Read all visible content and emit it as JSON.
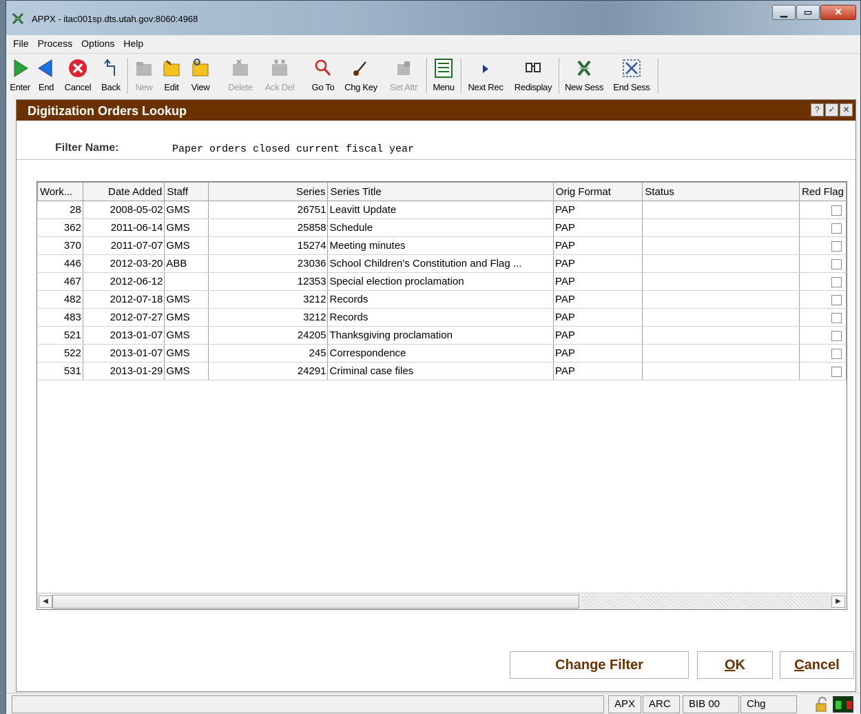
{
  "window": {
    "title": "APPX - itac001sp.dts.utah.gov:8060:4968",
    "controls": [
      "minimize",
      "maximize",
      "close"
    ]
  },
  "menu": [
    "File",
    "Process",
    "Options",
    "Help"
  ],
  "toolbar": {
    "buttons": [
      {
        "label": "Enter",
        "icon": "enter-arrow-icon",
        "enabled": true
      },
      {
        "label": "End",
        "icon": "end-arrow-icon",
        "enabled": true
      },
      {
        "label": "Cancel",
        "icon": "cancel-x-icon",
        "enabled": true
      },
      {
        "label": "Back",
        "icon": "back-arrow-icon",
        "enabled": true
      },
      {
        "label": "New",
        "icon": "new-folder-icon",
        "enabled": false
      },
      {
        "label": "Edit",
        "icon": "edit-folder-icon",
        "enabled": true
      },
      {
        "label": "View",
        "icon": "view-folder-icon",
        "enabled": true
      },
      {
        "label": "Delete",
        "icon": "delete-folder-icon",
        "enabled": false
      },
      {
        "label": "Ack Del",
        "icon": "ack-del-folder-icon",
        "enabled": false
      },
      {
        "label": "Go To",
        "icon": "magnifier-icon",
        "enabled": true
      },
      {
        "label": "Chg Key",
        "icon": "change-key-icon",
        "enabled": true
      },
      {
        "label": "Set Attr",
        "icon": "set-attr-icon",
        "enabled": false
      },
      {
        "label": "Menu",
        "icon": "menu-list-icon",
        "enabled": true
      },
      {
        "label": "Next Rec",
        "icon": "next-record-icon",
        "enabled": true
      },
      {
        "label": "Redisplay",
        "icon": "binoculars-icon",
        "enabled": true
      },
      {
        "label": "New Sess",
        "icon": "new-session-icon",
        "enabled": true
      },
      {
        "label": "End Sess",
        "icon": "end-session-icon",
        "enabled": true
      }
    ]
  },
  "dialog": {
    "title": "Digitization Orders Lookup",
    "controls": [
      "?",
      "✓",
      "✕"
    ],
    "filter_label": "Filter Name:",
    "filter_value": "Paper orders closed current fiscal year",
    "columns": [
      "Work...",
      "Date Added",
      "Staff",
      "Series",
      "Series Title",
      "Orig Format",
      "Status",
      "Red Flag"
    ],
    "rows": [
      {
        "work": "28",
        "date": "2008-05-02",
        "staff": "GMS",
        "series": "26751",
        "title": "Leavitt Update",
        "format": "PAP",
        "status": "",
        "red_flag": false
      },
      {
        "work": "362",
        "date": "2011-06-14",
        "staff": "GMS",
        "series": "25858",
        "title": "Schedule",
        "format": "PAP",
        "status": "",
        "red_flag": false
      },
      {
        "work": "370",
        "date": "2011-07-07",
        "staff": "GMS",
        "series": "15274",
        "title": "Meeting minutes",
        "format": "PAP",
        "status": "",
        "red_flag": false
      },
      {
        "work": "446",
        "date": "2012-03-20",
        "staff": "ABB",
        "series": "23036",
        "title": "School Children's Constitution and Flag ...",
        "format": "PAP",
        "status": "",
        "red_flag": false
      },
      {
        "work": "467",
        "date": "2012-06-12",
        "staff": "",
        "series": "12353",
        "title": "Special election proclamation",
        "format": "PAP",
        "status": "",
        "red_flag": false
      },
      {
        "work": "482",
        "date": "2012-07-18",
        "staff": "GMS",
        "series": "3212",
        "title": "Records",
        "format": "PAP",
        "status": "",
        "red_flag": false
      },
      {
        "work": "483",
        "date": "2012-07-27",
        "staff": "GMS",
        "series": "3212",
        "title": "Records",
        "format": "PAP",
        "status": "",
        "red_flag": false
      },
      {
        "work": "521",
        "date": "2013-01-07",
        "staff": "GMS",
        "series": "24205",
        "title": "Thanksgiving proclamation",
        "format": "PAP",
        "status": "",
        "red_flag": false
      },
      {
        "work": "522",
        "date": "2013-01-07",
        "staff": "GMS",
        "series": "245",
        "title": "Correspondence",
        "format": "PAP",
        "status": "",
        "red_flag": false
      },
      {
        "work": "531",
        "date": "2013-01-29",
        "staff": "GMS",
        "series": "24291",
        "title": "Criminal case files",
        "format": "PAP",
        "status": "",
        "red_flag": false
      }
    ],
    "buttons": {
      "change_filter": "Change Filter",
      "ok_mnemonic": "O",
      "ok_rest": "K",
      "cancel_mnemonic": "C",
      "cancel_rest": "ancel"
    }
  },
  "statusbar": {
    "message": "",
    "fields": [
      "APX",
      "ARC",
      "BIB 00",
      "Chg"
    ]
  },
  "colors": {
    "dialog_header": "#6b3200",
    "button_text": "#6b3200"
  }
}
